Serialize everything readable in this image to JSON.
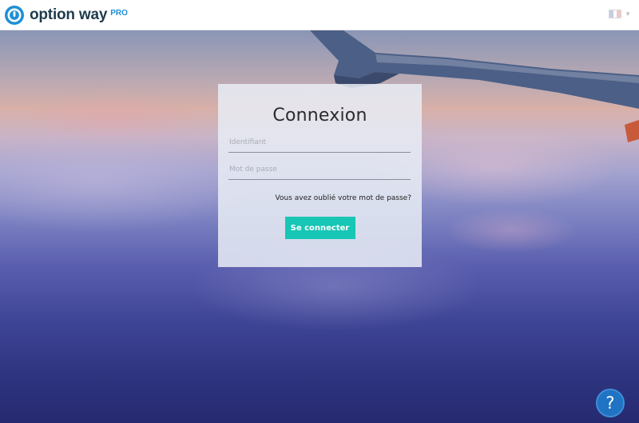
{
  "header": {
    "brand": "option way",
    "brand_tag": "PRO",
    "language_flag": "flag-fr-icon"
  },
  "login": {
    "title": "Connexion",
    "identifier_placeholder": "Identifiant",
    "identifier_value": "",
    "password_placeholder": "Mot de passe",
    "password_value": "",
    "forgot_password": "Vous avez oublié votre mot de passe?",
    "submit_label": "Se connecter"
  },
  "help": {
    "label": "?"
  },
  "colors": {
    "brand_blue": "#1e8fd6",
    "accent_teal": "#17c6b4",
    "help_blue": "#1f73c2"
  }
}
